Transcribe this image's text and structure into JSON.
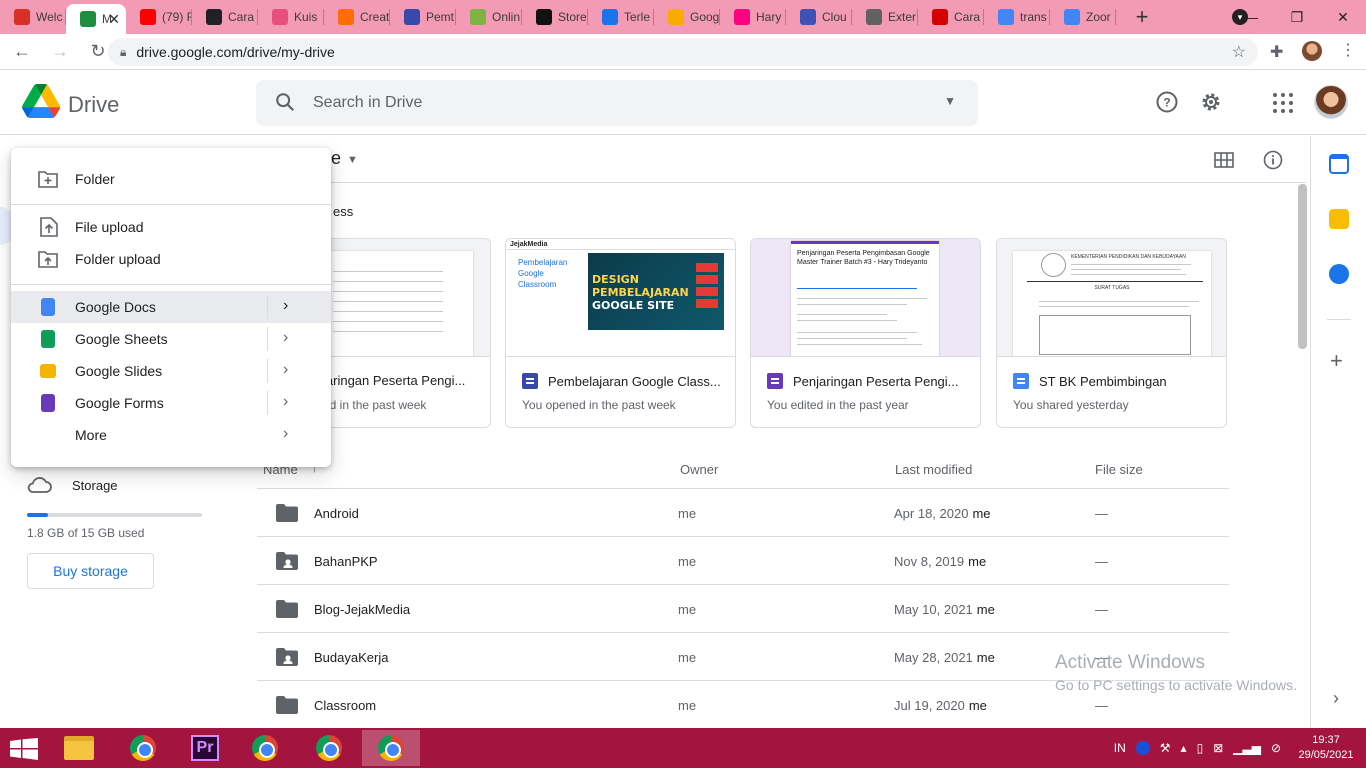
{
  "browser": {
    "tabs": [
      {
        "label": "Welc",
        "color": "#d93025"
      },
      {
        "label": "M",
        "color": "#1e8e3e",
        "active": true
      },
      {
        "label": "(79) F",
        "color": "#ff0000"
      },
      {
        "label": "Cara",
        "color": "#202124"
      },
      {
        "label": "Kuis",
        "color": "#e94f7a"
      },
      {
        "label": "Creat",
        "color": "#ff6d00"
      },
      {
        "label": "Pemt",
        "color": "#3949ab"
      },
      {
        "label": "Onlin",
        "color": "#7cb342"
      },
      {
        "label": "Store",
        "color": "#111111"
      },
      {
        "label": "Terle",
        "color": "#1a73e8"
      },
      {
        "label": "Goog",
        "color": "#f9ab00"
      },
      {
        "label": "Hary",
        "color": "#ff0084"
      },
      {
        "label": "Clou",
        "color": "#3f51b5"
      },
      {
        "label": "Exter",
        "color": "#616161"
      },
      {
        "label": "Cara",
        "color": "#d50000"
      },
      {
        "label": "trans",
        "color": "#4285f4"
      },
      {
        "label": "Zoor",
        "color": "#4285f4"
      }
    ],
    "url": "drive.google.com/drive/my-drive"
  },
  "drive": {
    "app_name": "Drive",
    "search_placeholder": "Search in Drive",
    "my_drive_fragment": "e",
    "section_fragment": "ess"
  },
  "new_menu": {
    "folder": "Folder",
    "file_upload": "File upload",
    "folder_upload": "Folder upload",
    "docs": "Google Docs",
    "sheets": "Google Sheets",
    "slides": "Google Slides",
    "forms": "Google Forms",
    "more": "More"
  },
  "storage": {
    "label": "Storage",
    "used_text": "1.8 GB of 15 GB used",
    "used_fraction": 0.12,
    "buy_label": "Buy storage"
  },
  "suggested": [
    {
      "title": "jaringan Peserta Pengi...",
      "sub": "ed in the past week",
      "icon": "forms"
    },
    {
      "title": "Pembelajaran Google Class...",
      "sub": "You opened in the past week",
      "icon": "sites"
    },
    {
      "title": "Penjaringan Peserta Pengi...",
      "sub": "You edited in the past year",
      "icon": "forms"
    },
    {
      "title": "ST BK Pembimbingan",
      "sub": "You shared yesterday",
      "icon": "docs"
    }
  ],
  "thumbs": {
    "jm_logo": "JejakMedia",
    "jm_side": [
      "Pembelajaran",
      "Google",
      "Classroom"
    ],
    "jm_big": [
      "DESIGN",
      "PEMBELAJARAN",
      "GOOGLE SITE"
    ],
    "form_title": "Penjaringan Peserta Pengimbasan Google Master Trainer Batch #3 - Hary Trideyanto",
    "doc_header": "KEMENTERIAN PENDIDIKAN DAN KEBUDAYAAN",
    "doc_title": "SURAT TUGAS"
  },
  "list": {
    "headers": {
      "name": "Name",
      "owner": "Owner",
      "modified": "Last modified",
      "size": "File size"
    },
    "rows": [
      {
        "name": "Android",
        "owner": "me",
        "date": "Apr 18, 2020",
        "by": "me",
        "size": "—",
        "shared": false
      },
      {
        "name": "BahanPKP",
        "owner": "me",
        "date": "Nov 8, 2019",
        "by": "me",
        "size": "—",
        "shared": true
      },
      {
        "name": "Blog-JejakMedia",
        "owner": "me",
        "date": "May 10, 2021",
        "by": "me",
        "size": "—",
        "shared": false
      },
      {
        "name": "BudayaKerja",
        "owner": "me",
        "date": "May 28, 2021",
        "by": "me",
        "size": "—",
        "shared": true
      },
      {
        "name": "Classroom",
        "owner": "me",
        "date": "Jul 19, 2020",
        "by": "me",
        "size": "—",
        "shared": false
      }
    ]
  },
  "watermark": {
    "line1": "Activate Windows",
    "line2": "Go to PC settings to activate Windows."
  },
  "taskbar": {
    "lang": "IN",
    "time": "19:37",
    "date": "29/05/2021",
    "premiere_label": "Pr"
  }
}
